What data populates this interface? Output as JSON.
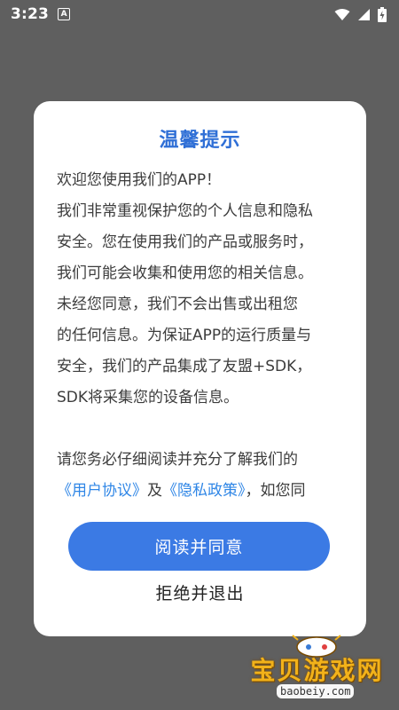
{
  "status_bar": {
    "time": "3:23",
    "notification_icon_letter": "A",
    "icons": [
      "wifi-icon",
      "signal-icon",
      "battery-icon"
    ]
  },
  "dialog": {
    "title": "温馨提示",
    "lines": [
      "欢迎您使用我们的APP！",
      "我们非常重视保护您的个人信息和隐私",
      "安全。您在使用我们的产品或服务时，",
      "我们可能会收集和使用您的相关信息。",
      "未经您同意，我们不会出售或出租您",
      "的任何信息。为保证APP的运行质量与",
      "安全，我们的产品集成了友盟+SDK，",
      "SDK将采集您的设备信息。"
    ],
    "line_after_gap": "请您务必仔细阅读并充分了解我们的",
    "link_user_agreement": "《用户协议》",
    "connector": "及",
    "link_privacy_policy": "《隐私政策》",
    "trailing_text": "，如您同",
    "agree_button": "阅读并同意",
    "decline_button": "拒绝并退出"
  },
  "watermark": {
    "name": "宝贝游戏网",
    "url": "baobeiy.com"
  },
  "colors": {
    "title": "#2f6fd6",
    "primary_button": "#3b7ae4",
    "link": "#2f86e6",
    "overlay": "#5f5f5f"
  }
}
